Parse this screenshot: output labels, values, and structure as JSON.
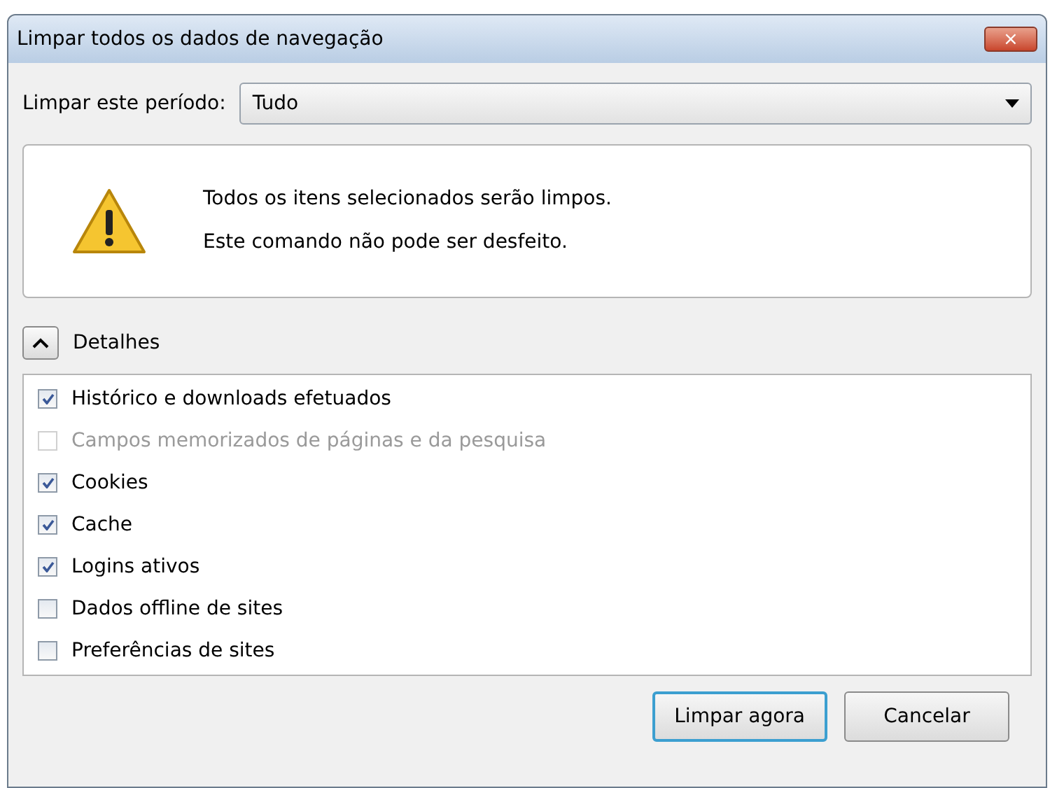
{
  "window": {
    "title": "Limpar todos os dados de navegação",
    "close": "×"
  },
  "period": {
    "label": "Limpar este período:",
    "value": "Tudo"
  },
  "warning": {
    "lines": [
      "Todos os itens selecionados serão limpos.",
      "Este comando não pode ser desfeito."
    ]
  },
  "details": {
    "label": "Detalhes",
    "expanded": true
  },
  "items": [
    {
      "label": "Histórico e downloads efetuados",
      "checked": true,
      "disabled": false
    },
    {
      "label": "Campos memorizados de páginas e da pesquisa",
      "checked": false,
      "disabled": true
    },
    {
      "label": "Cookies",
      "checked": true,
      "disabled": false
    },
    {
      "label": "Cache",
      "checked": true,
      "disabled": false
    },
    {
      "label": "Logins ativos",
      "checked": true,
      "disabled": false
    },
    {
      "label": "Dados offline de sites",
      "checked": false,
      "disabled": false
    },
    {
      "label": "Preferências de sites",
      "checked": false,
      "disabled": false
    }
  ],
  "buttons": [
    {
      "label": "Limpar agora",
      "default": true
    },
    {
      "label": "Cancelar",
      "default": false
    }
  ]
}
